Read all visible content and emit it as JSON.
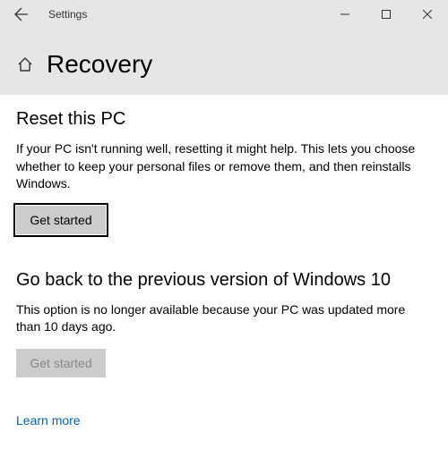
{
  "titlebar": {
    "app_title": "Settings"
  },
  "header": {
    "page_title": "Recovery"
  },
  "sections": {
    "reset": {
      "heading": "Reset this PC",
      "description": "If your PC isn't running well, resetting it might help. This lets you choose whether to keep your personal files or remove them, and then reinstalls Windows.",
      "button_label": "Get started"
    },
    "goback": {
      "heading": "Go back to the previous version of Windows 10",
      "description": "This option is no longer available because your PC was updated more than 10 days ago.",
      "button_label": "Get started"
    }
  },
  "learn_more_label": "Learn more"
}
